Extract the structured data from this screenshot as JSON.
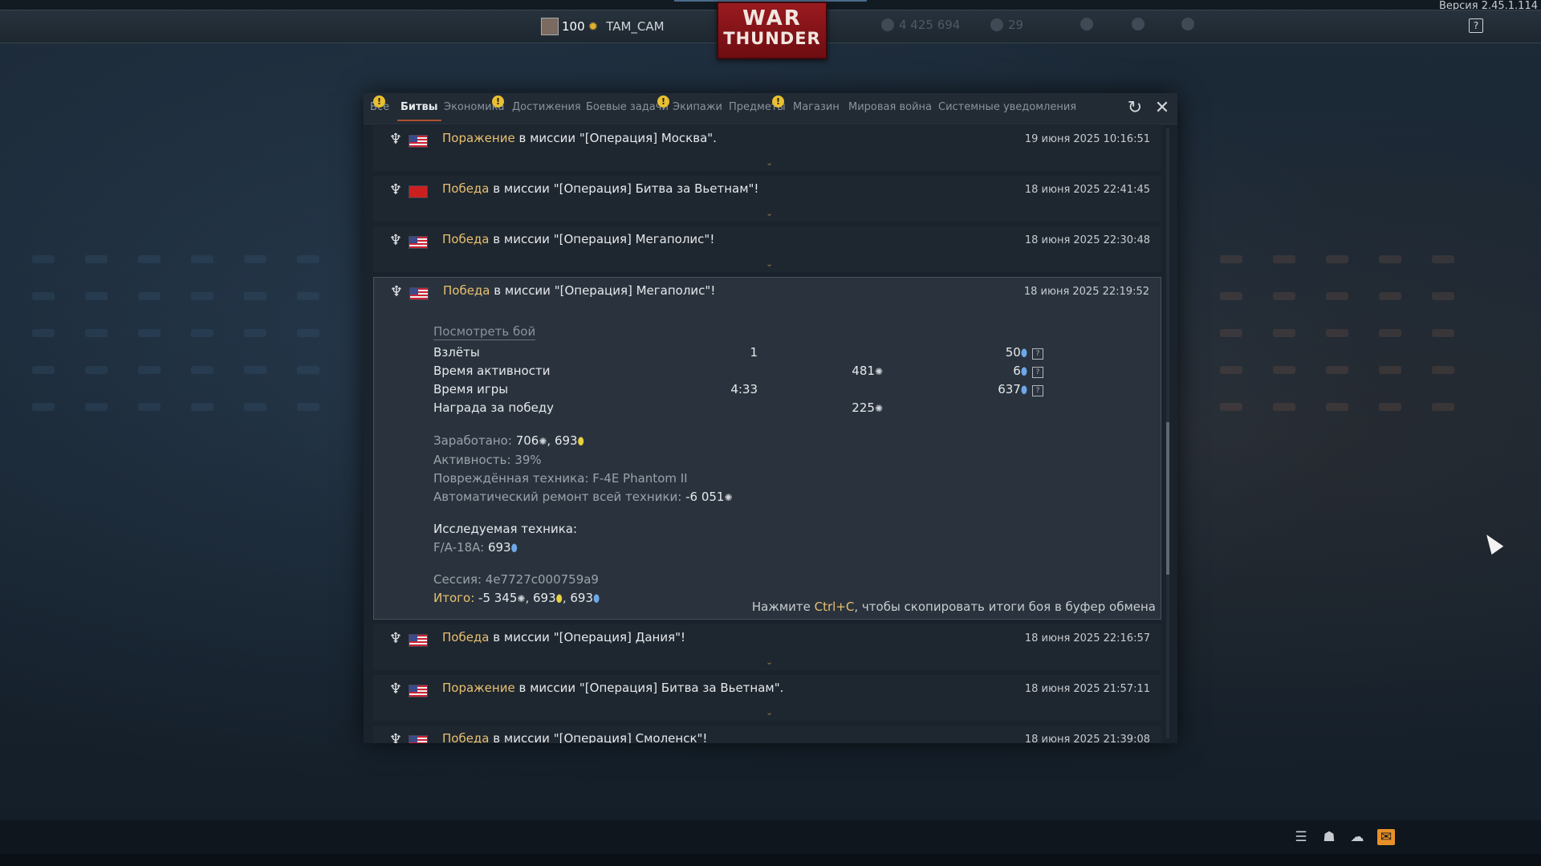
{
  "topbar": {
    "version": "Версия 2.45.1.114",
    "player_level": "100",
    "player_nick": "TAM_CAM",
    "logo_line1": "WAR",
    "logo_line2": "THUNDER",
    "silver_lions": "4 425 694",
    "eagles": "29"
  },
  "tabs": [
    {
      "label": "Все",
      "warning": true
    },
    {
      "label": "Битвы",
      "active": true
    },
    {
      "label": "Экономика",
      "warning": true
    },
    {
      "label": "Достижения"
    },
    {
      "label": "Боевые задачи",
      "warning": true
    },
    {
      "label": "Экипажи"
    },
    {
      "label": "Предметы",
      "warning": true
    },
    {
      "label": "Магазин"
    },
    {
      "label": "Мировая война"
    },
    {
      "label": "Системные уведомления"
    }
  ],
  "warning_mark": "!",
  "items": [
    {
      "result": "Поражение",
      "text": " в миссии \"[Операция] Москва\".",
      "date": "19 июня 2025 10:16:51",
      "flag": "us"
    },
    {
      "result": "Победа",
      "text": " в миссии \"[Операция] Битва за Вьетнам\"!",
      "date": "18 июня 2025 22:41:45",
      "flag": "vn"
    },
    {
      "result": "Победа",
      "text": " в миссии \"[Операция] Мегаполис\"!",
      "date": "18 июня 2025 22:30:48",
      "flag": "us"
    },
    {
      "result": "Победа",
      "text": " в миссии \"[Операция] Мегаполис\"!",
      "date": "18 июня 2025 22:19:52",
      "flag": "us"
    },
    {
      "result": "Победа",
      "text": " в миссии \"[Операция] Дания\"!",
      "date": "18 июня 2025 22:16:57",
      "flag": "us"
    },
    {
      "result": "Поражение",
      "text": " в миссии \"[Операция] Битва за Вьетнам\".",
      "date": "18 июня 2025 21:57:11",
      "flag": "us"
    },
    {
      "result": "Победа",
      "text": " в миссии \"[Операция] Смоленск\"!",
      "date": "18 июня 2025 21:39:08",
      "flag": "us"
    }
  ],
  "detail": {
    "view_battle": "Посмотреть бой",
    "rows": [
      {
        "label": "Взлёты",
        "v1": "1",
        "v2": "",
        "v3": "50"
      },
      {
        "label": "Время активности",
        "v1": "",
        "v2": "481",
        "v3": "6"
      },
      {
        "label": "Время игры",
        "v1": "4:33",
        "v2": "",
        "v3": "637"
      },
      {
        "label": "Награда за победу",
        "v1": "",
        "v2": "225",
        "v3": ""
      }
    ],
    "earned_label": "Заработано:",
    "earned_sl": "706",
    "earned_rp": "693",
    "activity": "Активность: 39%",
    "damaged": "Повреждённая техника: F-4E Phantom II",
    "repair_label": "Автоматический ремонт всей техники:",
    "repair_value": "-6 051",
    "research_header": "Исследуемая техника:",
    "research_vehicle": "F/A-18A:",
    "research_value": "693",
    "session": "Сессия: 4e7727c000759a9",
    "total_label": "Итого:",
    "total_sl": "-5 345",
    "total_rp1": "693",
    "total_rp2": "693",
    "copy_pre": "Нажмите ",
    "copy_key": "Ctrl+C",
    "copy_post": ", чтобы скопировать итоги боя в буфер обмена"
  },
  "colors": {
    "result_word": "#e8c070",
    "active_tab_underline": "#b05030",
    "warning_badge": "#e8c030",
    "mail_button": "#e89028"
  }
}
